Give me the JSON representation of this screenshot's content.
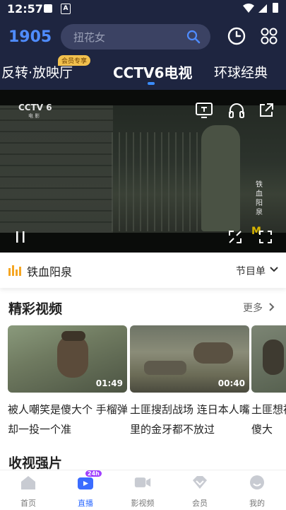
{
  "status_bar": {
    "time": "12:57"
  },
  "header": {
    "logo_text": "1905",
    "search_placeholder": "扭花女",
    "colors": {
      "accent": "#3a8dff",
      "header_bg": "#1e2540"
    }
  },
  "channel_tabs": [
    {
      "label": "反转·放映厅",
      "badge": "会员专享"
    },
    {
      "label": "CCTV6电视",
      "active": true
    },
    {
      "label": "环球经典"
    }
  ],
  "player": {
    "channel_logo": "CCTV 6",
    "channel_sub": "电 影",
    "watermark": "铁血阳泉",
    "corner_logo": "M"
  },
  "now_playing": {
    "title": "铁血阳泉",
    "schedule_label": "节目单"
  },
  "featured": {
    "title": "精彩视频",
    "more_label": "更多",
    "items": [
      {
        "duration": "01:49",
        "title": "被人嘲笑是傻大个 手榴弹却一投一个准"
      },
      {
        "duration": "00:40",
        "title": "土匪搜刮战场 连日本人嘴里的金牙都不放过"
      },
      {
        "duration": "",
        "title": "土匪想被傻大"
      }
    ]
  },
  "section2": {
    "title": "收视强片"
  },
  "bottom_nav": [
    {
      "label": "首页",
      "icon": "home-icon"
    },
    {
      "label": "直播",
      "icon": "live-icon",
      "badge": "24h",
      "active": true
    },
    {
      "label": "影视频",
      "icon": "video-icon"
    },
    {
      "label": "会员",
      "icon": "vip-icon"
    },
    {
      "label": "我的",
      "icon": "profile-icon"
    }
  ]
}
